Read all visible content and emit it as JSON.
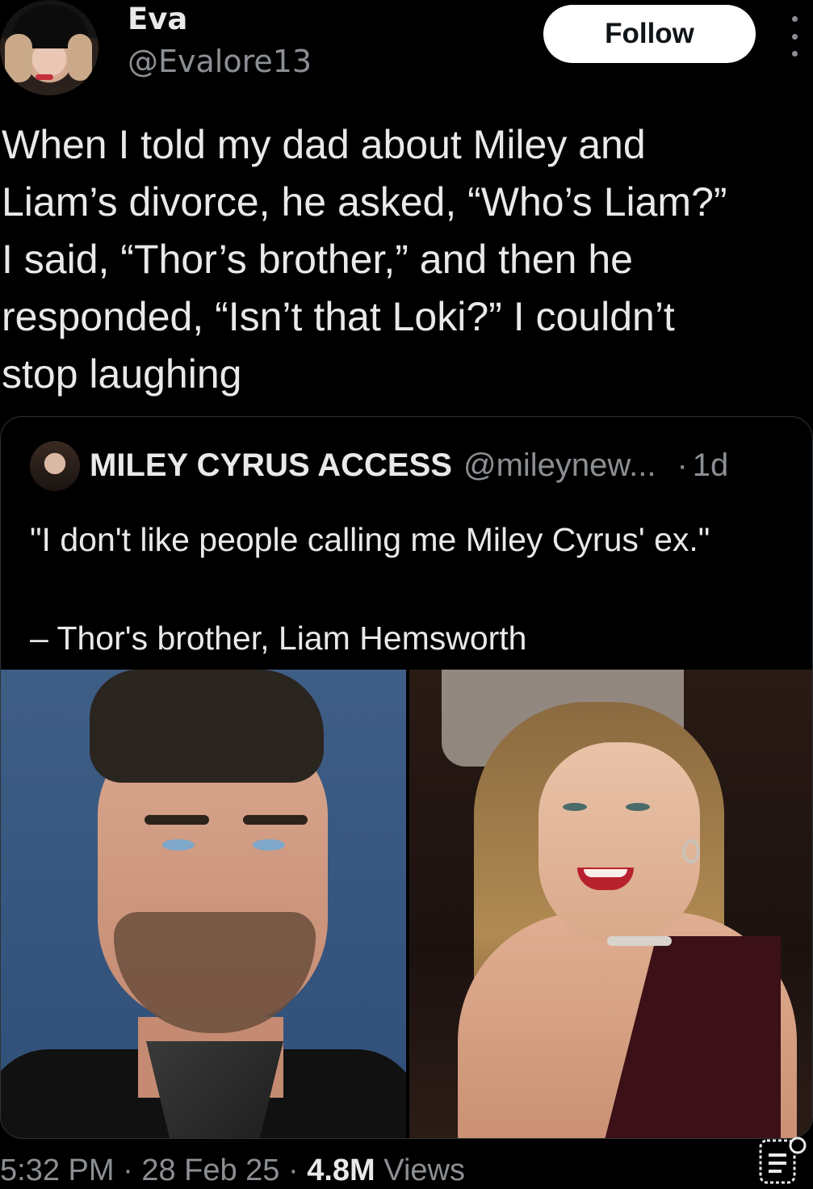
{
  "author": {
    "display_name": "Eva",
    "handle": "@Evalore13",
    "follow_label": "Follow"
  },
  "tweet": {
    "text": "When I told my dad about Miley and\nLiam’s divorce, he asked, “Who’s Liam?”\nI said, “Thor’s brother,” and then he\nresponded, “Isn’t that Loki?” I couldn’t\nstop laughing"
  },
  "quote": {
    "name": "MILEY CYRUS ACCESS",
    "handle": "@mileynew...",
    "separator": "·",
    "time": "1d",
    "line1": "\"I don't like people calling me Miley Cyrus' ex.\"",
    "line2": "– Thor's brother, Liam Hemsworth"
  },
  "meta": {
    "time": "5:32 PM",
    "date": "28 Feb 25",
    "views_count": "4.8M",
    "views_label": "Views",
    "sep": "·"
  },
  "icons": {
    "more": "more-vertical-icon",
    "analytics": "analytics-icon"
  },
  "colors": {
    "background": "#000000",
    "text": "#e7e9ea",
    "secondary": "#8b8f93",
    "border": "#2f3336",
    "follow_bg": "#ffffff"
  }
}
